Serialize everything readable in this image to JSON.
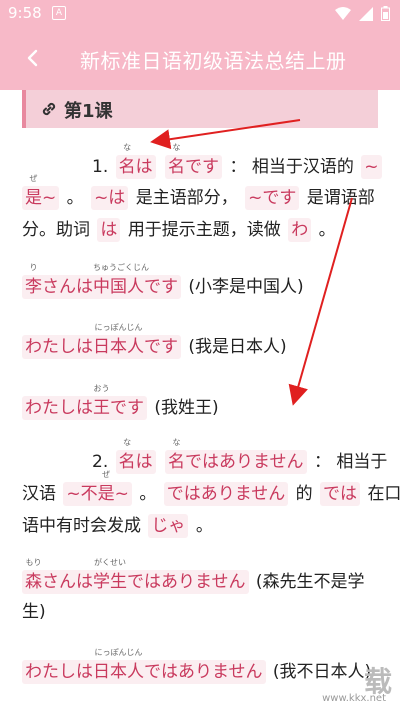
{
  "status": {
    "time": "9:58",
    "notif_glyph": "A"
  },
  "header": {
    "title": "新标准日语初级语法总结上册"
  },
  "lesson": {
    "title": "第1课"
  },
  "s1": {
    "num": "1.",
    "w1": "名",
    "w1_ruby": "な",
    "w1_rest": "は",
    "w2": "名",
    "w2_ruby": "な",
    "w2_rest": "です",
    "colon_text": "：  相当于汉语的",
    "hl1": "~",
    "l2_hl1a": "是",
    "l2_hl1a_ruby": "ぜ",
    "l2_hl1b": "~",
    "l2_t1": "。",
    "l2_hl2": "~は",
    "l2_t2": "是主语部分，",
    "l2_hl3": "~です",
    "l2_t3": "是谓语部",
    "l3_t1": "分。助词",
    "l3_hl1": "は",
    "l3_t2": "用于提示主题，读做",
    "l3_hl2": "わ",
    "l3_t3": "。"
  },
  "ex1": {
    "a": "李",
    "a_ruby": "り",
    "b": "さんは",
    "c": "中国人",
    "c_ruby": "ちゅうごくじん",
    "d": "です",
    "tr": "(小李是中国人)"
  },
  "ex2": {
    "a": "わたしは",
    "b": "日本人",
    "b_ruby": "にっぽんじん",
    "c": "です",
    "tr": "(我是日本人)"
  },
  "ex3": {
    "a": "わたしは",
    "b": "王",
    "b_ruby": "おう",
    "c": "です",
    "tr": "(我姓王)"
  },
  "s2": {
    "num": "2.",
    "w1": "名",
    "w1_ruby": "な",
    "w1_rest": "は",
    "w2": "名",
    "w2_ruby": "な",
    "w2_rest": "ではありません",
    "colon_text": "：  相当于",
    "l2_t1": "汉语",
    "l2_hl1a": "~不",
    "l2_hl1b": "是",
    "l2_hl1b_ruby": "ぜ",
    "l2_hl1c": "~",
    "l2_t2": "。",
    "l2_hl2": "ではありません",
    "l2_t3": "的",
    "l2_hl3": "では",
    "l2_t4": "在口",
    "l3_t1": "语中有时会发成",
    "l3_hl1": "じゃ",
    "l3_t2": "。"
  },
  "ex4": {
    "a": "森",
    "a_ruby": "もり",
    "b": "さんは",
    "c": "学生",
    "c_ruby": "がくせい",
    "d": "ではありません",
    "tr1": "(森先生不是学",
    "tr2": "生)"
  },
  "ex5": {
    "a": "わたしは",
    "b": "日本人",
    "b_ruby": "にっぽんじん",
    "c": "ではありません",
    "tr": "(我不日本人)"
  },
  "watermark": {
    "big": "载",
    "small": "www.kkx.net"
  },
  "colors": {
    "accent": "#f7b9c8",
    "highlight_text": "#c93a5e",
    "highlight_bg": "#fbeef1",
    "arrow": "#e02020"
  }
}
